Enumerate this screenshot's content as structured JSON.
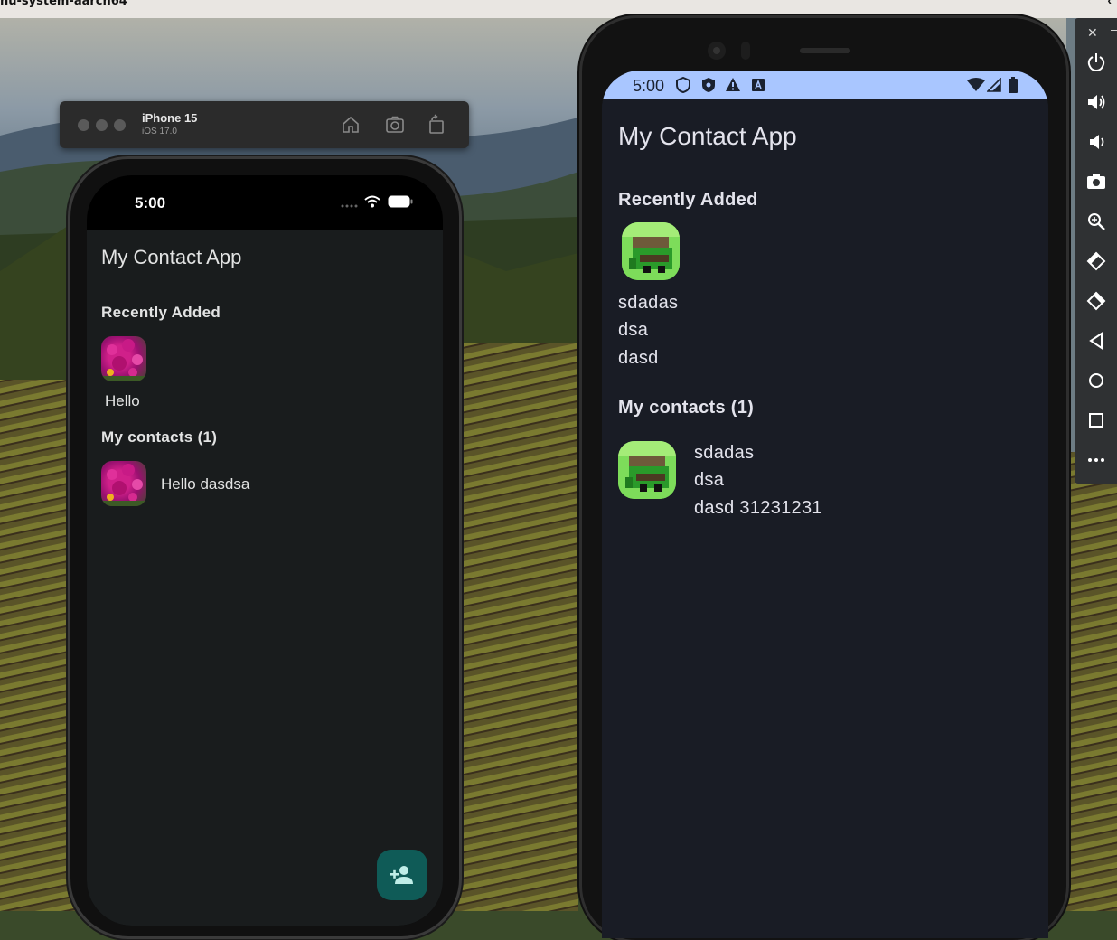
{
  "window": {
    "title": "nu-system-aarch64"
  },
  "ios_simulator": {
    "device_name": "iPhone 15",
    "os_version": "iOS 17.0",
    "status_time": "5:00",
    "toolbar_icons": [
      "home-icon",
      "screenshot-icon",
      "rotate-icon"
    ],
    "app": {
      "title": "My Contact App",
      "recent_heading": "Recently Added",
      "recent_contacts": [
        {
          "name": "Hello"
        }
      ],
      "contacts_heading": "My contacts (1)",
      "contacts": [
        {
          "label": "Hello dasdsa"
        }
      ],
      "fab_icon": "add-person-icon"
    }
  },
  "android_emulator": {
    "status_time": "5:00",
    "app": {
      "title": "My Contact App",
      "recent_heading": "Recently Added",
      "recent_contact": {
        "line1": "sdadas",
        "line2": "dsa",
        "line3": "dasd"
      },
      "contacts_heading": "My contacts (1)",
      "contacts": [
        {
          "line1": "sdadas",
          "line2": "dsa",
          "line3": "dasd 31231231"
        }
      ]
    },
    "side_panel_icons": [
      "power-icon",
      "volume-up-icon",
      "volume-down-icon",
      "camera-icon",
      "zoom-icon",
      "rotate-left-icon",
      "rotate-right-icon",
      "back-icon",
      "home-icon",
      "overview-icon",
      "more-icon"
    ]
  },
  "colors": {
    "ios_background": "#191c1d",
    "android_background": "#191c25",
    "android_statusbar": "#a9c6ff",
    "fab": "#0f5b57"
  }
}
